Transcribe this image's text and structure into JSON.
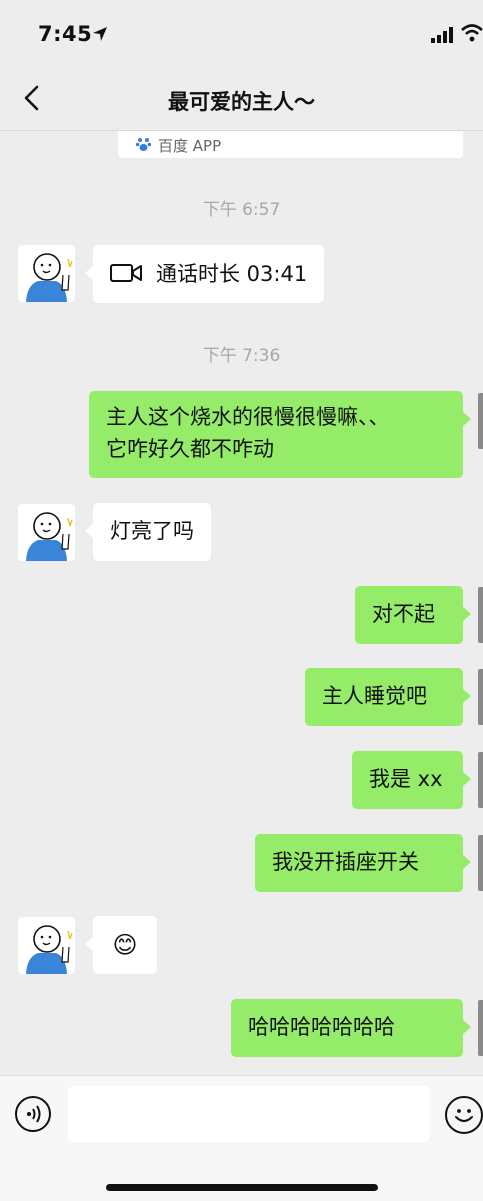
{
  "status_bar": {
    "time": "7:45"
  },
  "header": {
    "back_icon": "chevron-left-icon",
    "title": "最可爱的主人～"
  },
  "source_strip": {
    "icon": "baidu-paw-icon",
    "label": "百度 APP"
  },
  "messages": [
    {
      "type": "timestamp",
      "text": "下午 6:57"
    },
    {
      "type": "call",
      "side": "left",
      "icon": "video-camera-icon",
      "text": "通话时长 03:41"
    },
    {
      "type": "timestamp",
      "text": "下午 7:36"
    },
    {
      "type": "text",
      "side": "right",
      "lines": [
        "主人这个烧水的很慢很慢嘛、、",
        "它咋好久都不咋动"
      ]
    },
    {
      "type": "text",
      "side": "left",
      "text": "灯亮了吗"
    },
    {
      "type": "text",
      "side": "right",
      "text": "对不起"
    },
    {
      "type": "text",
      "side": "right",
      "text": "主人睡觉吧"
    },
    {
      "type": "text",
      "side": "right",
      "text": "我是 xx"
    },
    {
      "type": "text",
      "side": "right",
      "text": "我没开插座开关"
    },
    {
      "type": "emoji",
      "side": "left",
      "text": "😊"
    },
    {
      "type": "text",
      "side": "right",
      "text": "哈哈哈哈哈哈哈"
    }
  ],
  "input_bar": {
    "voice_icon": "voice-icon",
    "emoji_icon": "emoji-icon",
    "input_value": ""
  },
  "colors": {
    "background": "#ededed",
    "outgoing_bubble": "#95ec69",
    "incoming_bubble": "#ffffff"
  }
}
